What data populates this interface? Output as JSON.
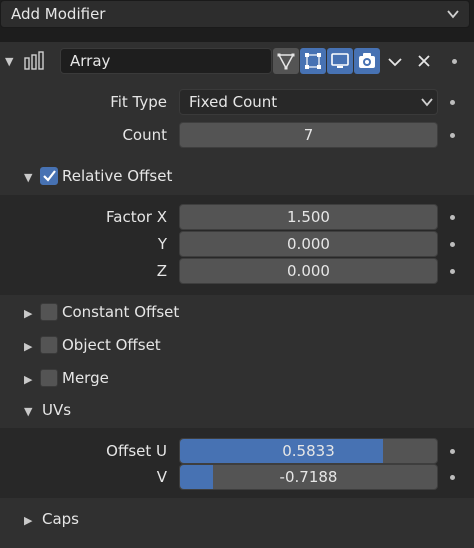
{
  "add_modifier": {
    "label": "Add Modifier"
  },
  "modifier": {
    "name": "Array",
    "icons": [
      "array-modifier-icon",
      "edit-mode-icon",
      "on-cage-icon",
      "realtime-display-icon",
      "render-camera-icon",
      "chevron-down-icon",
      "close-icon"
    ],
    "accent": "#4772b3"
  },
  "fit_type": {
    "label": "Fit Type",
    "value": "Fixed Count"
  },
  "count": {
    "label": "Count",
    "value": "7"
  },
  "relative_offset": {
    "label": "Relative Offset",
    "checked": true,
    "factor_x": {
      "label": "Factor X",
      "value": "1.500"
    },
    "y": {
      "label": "Y",
      "value": "0.000"
    },
    "z": {
      "label": "Z",
      "value": "0.000"
    }
  },
  "constant_offset": {
    "label": "Constant Offset",
    "checked": false
  },
  "object_offset": {
    "label": "Object Offset",
    "checked": false
  },
  "merge": {
    "label": "Merge",
    "checked": false
  },
  "uvs": {
    "label": "UVs",
    "offset_u": {
      "label": "Offset U",
      "value": "0.5833",
      "fill": 0.79
    },
    "v": {
      "label": "V",
      "value": "-0.7188",
      "fill": 0.13
    }
  },
  "caps": {
    "label": "Caps"
  }
}
